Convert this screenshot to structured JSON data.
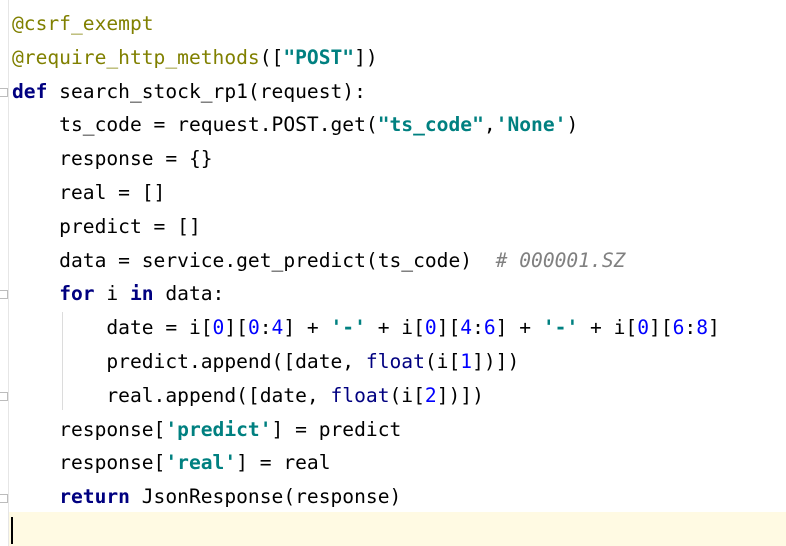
{
  "editor": {
    "lines": [
      [
        {
          "t": "@csrf_exempt",
          "c": "dec"
        }
      ],
      [
        {
          "t": "@require_http_methods",
          "c": "dec"
        },
        {
          "t": "(["
        },
        {
          "t": "\"POST\"",
          "c": "str"
        },
        {
          "t": "])"
        }
      ],
      [
        {
          "t": "def",
          "c": "kw"
        },
        {
          "t": " search_stock_rp1(request):"
        }
      ],
      [
        {
          "t": "    ts_code = request.POST.get("
        },
        {
          "t": "\"ts_code\"",
          "c": "str"
        },
        {
          "t": ","
        },
        {
          "t": "'None'",
          "c": "str"
        },
        {
          "t": ")"
        }
      ],
      [
        {
          "t": "    response = {}"
        }
      ],
      [
        {
          "t": "    real = []"
        }
      ],
      [
        {
          "t": "    predict = []"
        }
      ],
      [
        {
          "t": "    data = service.get_predict(ts_code)  "
        },
        {
          "t": "# 000001.SZ",
          "c": "cmt"
        }
      ],
      [
        {
          "t": "    "
        },
        {
          "t": "for",
          "c": "kw"
        },
        {
          "t": " i "
        },
        {
          "t": "in",
          "c": "kw"
        },
        {
          "t": " data:"
        }
      ],
      [
        {
          "t": "        date = i["
        },
        {
          "t": "0",
          "c": "num"
        },
        {
          "t": "]["
        },
        {
          "t": "0",
          "c": "num"
        },
        {
          "t": ":"
        },
        {
          "t": "4",
          "c": "num"
        },
        {
          "t": "] + "
        },
        {
          "t": "'-'",
          "c": "str"
        },
        {
          "t": " + i["
        },
        {
          "t": "0",
          "c": "num"
        },
        {
          "t": "]["
        },
        {
          "t": "4",
          "c": "num"
        },
        {
          "t": ":"
        },
        {
          "t": "6",
          "c": "num"
        },
        {
          "t": "] + "
        },
        {
          "t": "'-'",
          "c": "str"
        },
        {
          "t": " + i["
        },
        {
          "t": "0",
          "c": "num"
        },
        {
          "t": "]["
        },
        {
          "t": "6",
          "c": "num"
        },
        {
          "t": ":"
        },
        {
          "t": "8",
          "c": "num"
        },
        {
          "t": "]"
        }
      ],
      [
        {
          "t": "        predict.append([date, "
        },
        {
          "t": "float",
          "c": "builtin"
        },
        {
          "t": "(i["
        },
        {
          "t": "1",
          "c": "num"
        },
        {
          "t": "])])"
        }
      ],
      [
        {
          "t": "        real.append([date, "
        },
        {
          "t": "float",
          "c": "builtin"
        },
        {
          "t": "(i["
        },
        {
          "t": "2",
          "c": "num"
        },
        {
          "t": "])])"
        }
      ],
      [
        {
          "t": "    response["
        },
        {
          "t": "'predict'",
          "c": "str"
        },
        {
          "t": "] = predict"
        }
      ],
      [
        {
          "t": "    response["
        },
        {
          "t": "'real'",
          "c": "str"
        },
        {
          "t": "] = real"
        }
      ],
      [
        {
          "t": "    "
        },
        {
          "t": "return",
          "c": "kw"
        },
        {
          "t": " JsonResponse(response)"
        }
      ],
      [
        {
          "t": ""
        }
      ]
    ]
  },
  "colors": {
    "decorator": "#808000",
    "keyword": "#000080",
    "string": "#008080",
    "number": "#0000ff",
    "comment": "#808080",
    "caret_line": "#fffae3"
  }
}
